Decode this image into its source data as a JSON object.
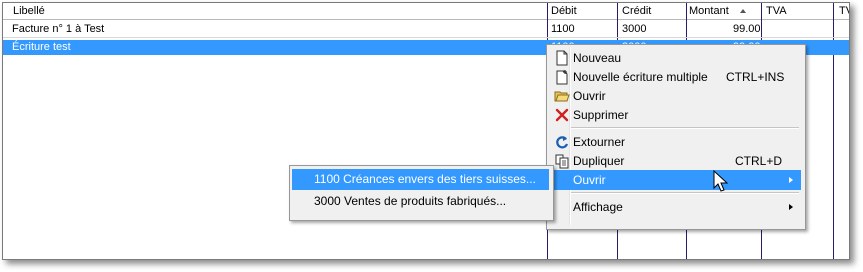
{
  "columns": {
    "libelle": "Libellé",
    "debit": "Débit",
    "credit": "Crédit",
    "montant": "Montant",
    "tva1": "TVA",
    "tva2": "TV"
  },
  "rows": [
    {
      "libelle": "Facture n° 1 à Test",
      "debit": "1100",
      "credit": "3000",
      "montant": "99.00"
    },
    {
      "libelle": "Écriture test",
      "debit": "1100",
      "credit": "3000",
      "montant": "99.00"
    }
  ],
  "context_menu": {
    "items": [
      {
        "label": "Nouveau",
        "icon": "new-document-icon"
      },
      {
        "label": "Nouvelle écriture multiple",
        "shortcut": "CTRL+INS",
        "icon": "new-multiple-entry-icon"
      },
      {
        "label": "Ouvrir",
        "icon": "open-folder-icon"
      },
      {
        "label": "Supprimer",
        "icon": "delete-x-icon"
      },
      {
        "label": "Extourner",
        "icon": "reverse-arrow-icon"
      },
      {
        "label": "Dupliquer",
        "shortcut": "CTRL+D",
        "icon": "duplicate-icon"
      },
      {
        "label": "Ouvrir",
        "submenu": true
      },
      {
        "label": "Affichage",
        "submenu": true
      }
    ]
  },
  "submenu": {
    "items": [
      "1100 Créances envers des tiers suisses...",
      "3000 Ventes de produits fabriqués..."
    ]
  },
  "colors": {
    "selection": "#3399ff",
    "column_line_purple": "#2a1a6e",
    "menu_background": "#f0f0f0"
  }
}
